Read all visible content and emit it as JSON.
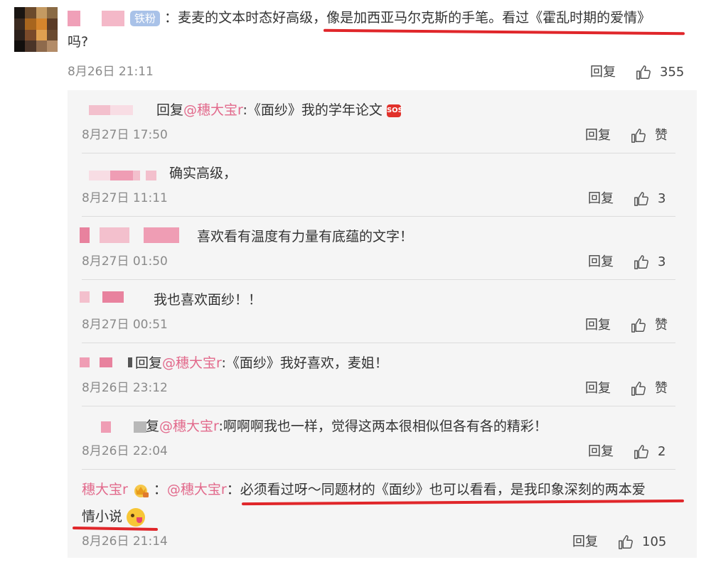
{
  "main": {
    "badge": "铁粉",
    "text_before": "：麦麦的文本时态好高级，",
    "text_highlight": "像是加西亚马尔克斯的手笔。看过《霍乱时期的爱情》",
    "text_line2": "吗?",
    "time": "8月26日 21:11",
    "reply_label": "回复",
    "likes": "355"
  },
  "replies": [
    {
      "text_prefix": "回复",
      "mention": "@穗大宝r",
      "text": ":《面纱》我的学年论文",
      "emoji": "SOS",
      "time": "8月27日 17:50",
      "reply_label": "回复",
      "likes": "赞"
    },
    {
      "text": "确实高级，",
      "time": "8月27日 11:11",
      "reply_label": "回复",
      "likes": "3"
    },
    {
      "text": "喜欢看有温度有力量有底蕴的文字！",
      "time": "8月27日 01:50",
      "reply_label": "回复",
      "likes": "3"
    },
    {
      "text": "我也喜欢面纱！！",
      "time": "8月27日 00:51",
      "reply_label": "回复",
      "likes": "赞"
    },
    {
      "text_prefix": "回复",
      "mention": "@穗大宝r",
      "text": ":《面纱》我好喜欢，麦姐！",
      "time": "8月26日 23:12",
      "reply_label": "回复",
      "likes": "赞"
    },
    {
      "text_prefix": "复",
      "mention": "@穗大宝r",
      "text": ":啊啊啊我也一样，觉得这两本很相似但各有各的精彩！",
      "time": "8月26日 22:04",
      "reply_label": "回复",
      "likes": "2"
    },
    {
      "author": "穗大宝r",
      "mention": "@穗大宝r",
      "text": "：必须看过呀～同题材的《面纱》也可以看看，是我印象深刻的两本爱",
      "text_line2": "情小说",
      "time": "8月26日 21:14",
      "reply_label": "回复",
      "likes": "105"
    }
  ],
  "colors": {
    "accent": "#e26a8c",
    "underline": "#e0262a",
    "badge": "#a9c2e8"
  }
}
